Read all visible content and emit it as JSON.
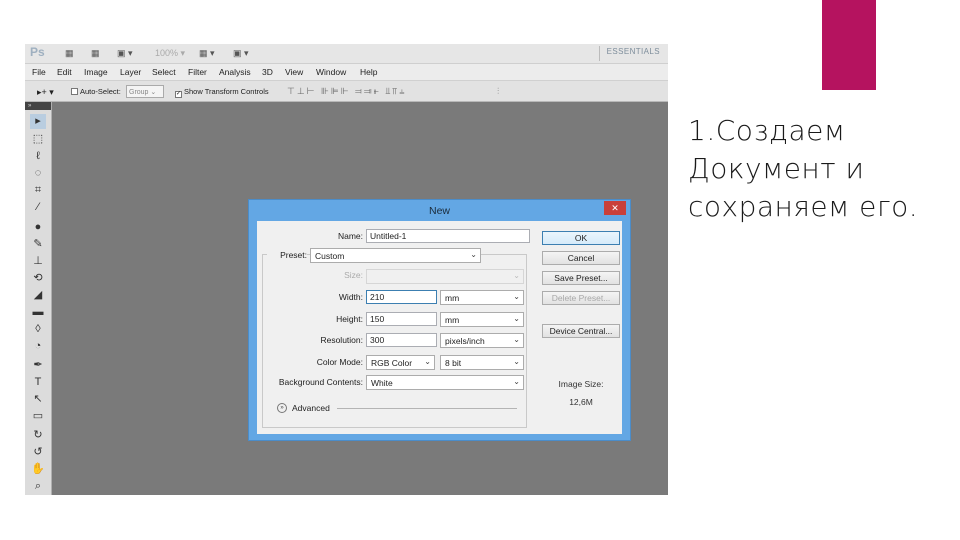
{
  "slide": {
    "text": "1.Создаем Документ и сохраняем его.",
    "accent_color": "#b5135f"
  },
  "ps_window": {
    "logo": "Ps",
    "zoom_value": "100%",
    "workspace": "ESSENTIALS",
    "menu": [
      "File",
      "Edit",
      "Image",
      "Layer",
      "Select",
      "Filter",
      "Analysis",
      "3D",
      "View",
      "Window",
      "Help"
    ],
    "options_bar": {
      "auto_select_label": "Auto-Select:",
      "auto_select_value": "Group",
      "show_transform_label": "Show Transform Controls"
    },
    "tools": [
      "move-tool",
      "marquee-tool",
      "lasso-tool",
      "quick-select-tool",
      "crop-tool",
      "eyedropper-tool",
      "spot-healing-tool",
      "brush-tool",
      "clone-stamp-tool",
      "history-brush-tool",
      "eraser-tool",
      "gradient-tool",
      "blur-tool",
      "dodge-tool",
      "pen-tool",
      "type-tool",
      "path-select-tool",
      "shape-tool",
      "3d-rotate-tool",
      "3d-orbit-tool",
      "hand-tool",
      "zoom-tool"
    ]
  },
  "dialog": {
    "title": "New",
    "close_glyph": "✕",
    "name_label": "Name:",
    "name_value": "Untitled-1",
    "preset_label": "Preset:",
    "preset_value": "Custom",
    "size_label": "Size:",
    "width_label": "Width:",
    "width_value": "210",
    "width_unit": "mm",
    "height_label": "Height:",
    "height_value": "150",
    "height_unit": "mm",
    "resolution_label": "Resolution:",
    "resolution_value": "300",
    "resolution_unit": "pixels/inch",
    "color_mode_label": "Color Mode:",
    "color_mode_value": "RGB Color",
    "bit_depth_value": "8 bit",
    "background_label": "Background Contents:",
    "background_value": "White",
    "advanced_label": "Advanced",
    "buttons": {
      "ok": "OK",
      "cancel": "Cancel",
      "save_preset": "Save Preset...",
      "delete_preset": "Delete Preset...",
      "device_central": "Device Central..."
    },
    "image_size_label": "Image Size:",
    "image_size_value": "12,6M"
  }
}
